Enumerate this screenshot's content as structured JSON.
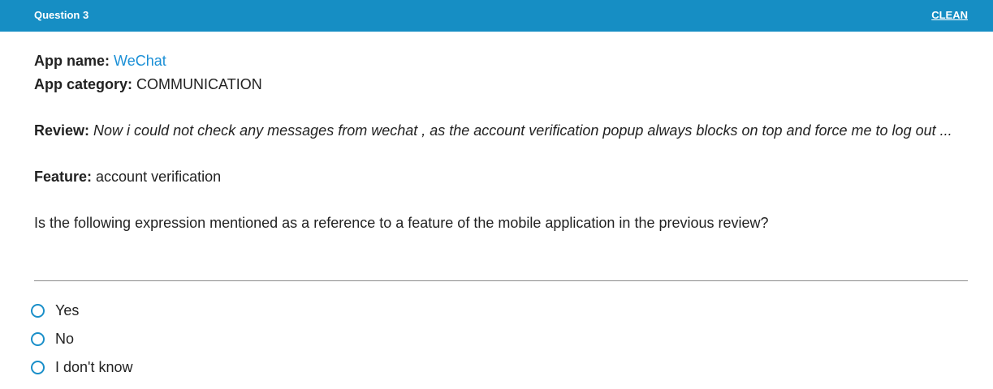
{
  "header": {
    "title": "Question 3",
    "clean_label": "CLEAN"
  },
  "app": {
    "name_label": "App name:",
    "name": "WeChat",
    "category_label": "App category:",
    "category": "COMMUNICATION"
  },
  "review": {
    "label": "Review:",
    "text": "Now i could not check any messages from wechat , as the account verification popup always blocks on top and force me to log out ..."
  },
  "feature": {
    "label": "Feature:",
    "text": "account verification"
  },
  "question": {
    "text": "Is the following expression mentioned as a reference to a feature of the mobile application in the previous review?"
  },
  "options": [
    {
      "label": "Yes"
    },
    {
      "label": "No"
    },
    {
      "label": "I don't know"
    }
  ],
  "colors": {
    "header_bg": "#168ec4",
    "accent": "#1a8fd6"
  }
}
